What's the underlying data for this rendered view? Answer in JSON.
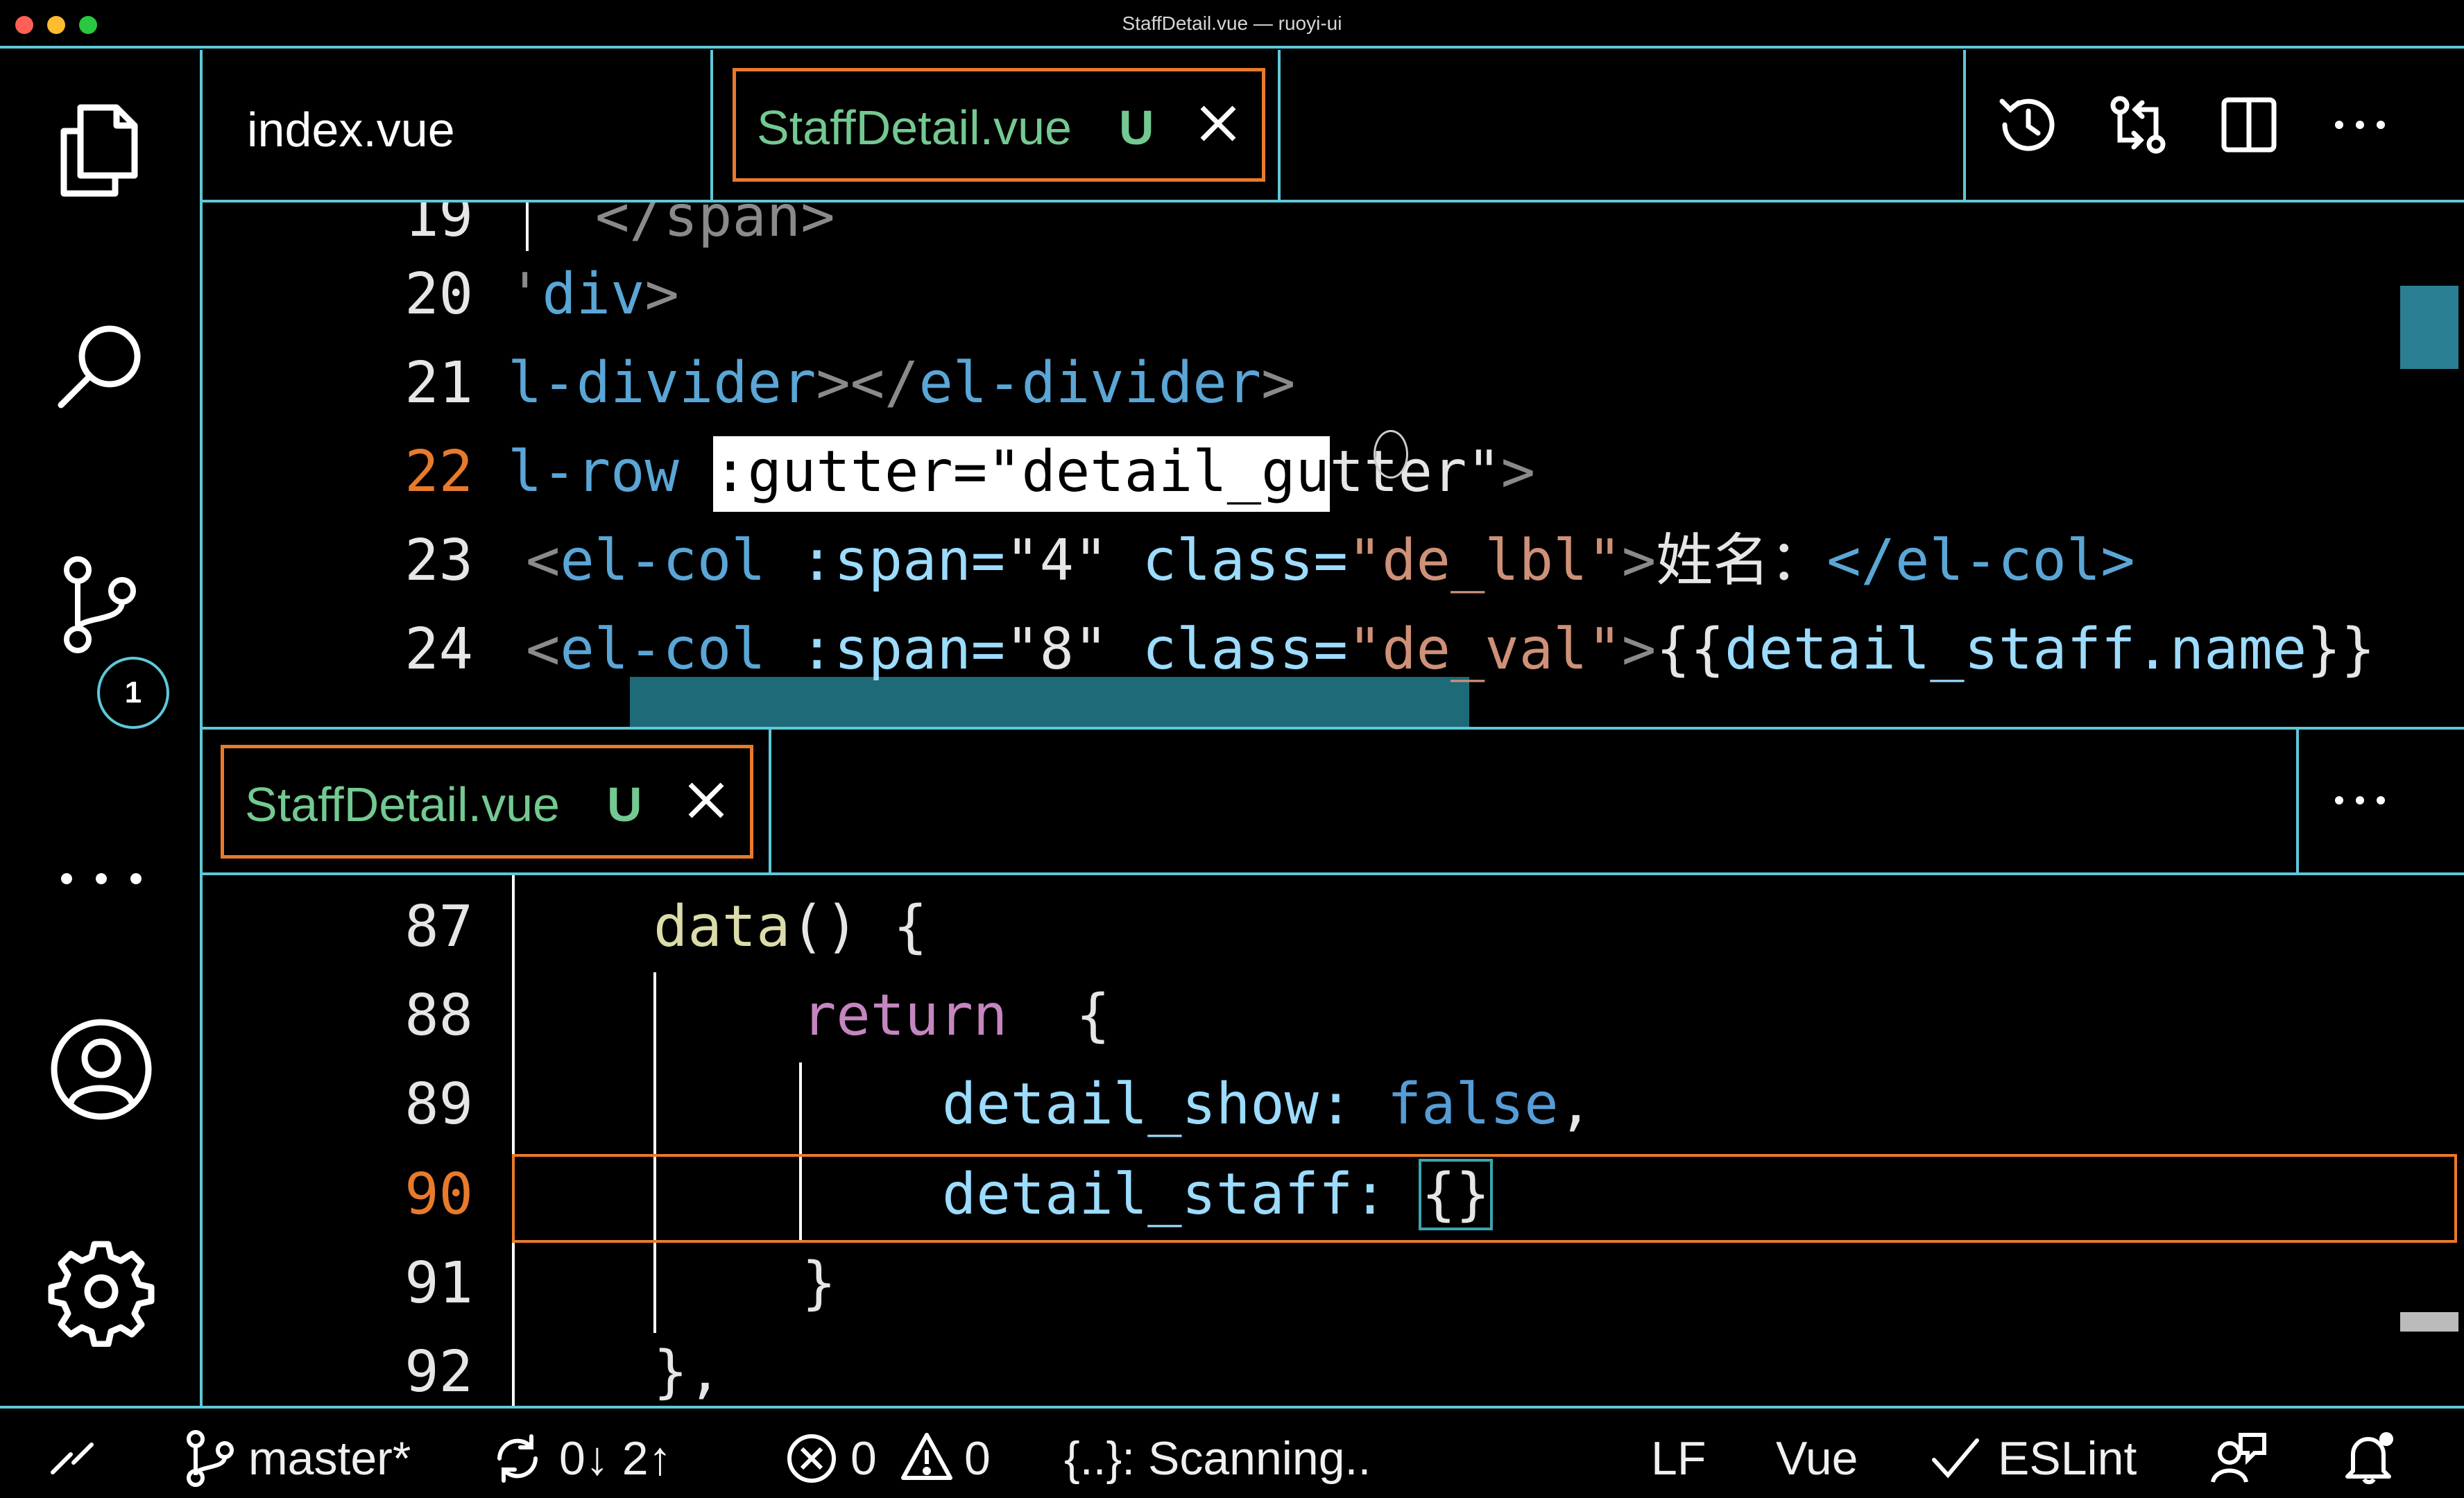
{
  "window": {
    "title": "StaffDetail.vue — ruoyi-ui"
  },
  "tabs_top": {
    "tab1": {
      "label": "index.vue"
    },
    "tab2": {
      "label": "StaffDetail.vue",
      "status": "U"
    }
  },
  "tabs_bottom": {
    "tab1": {
      "label": "StaffDetail.vue",
      "status": "U"
    }
  },
  "editor_top": {
    "line_numbers": [
      "19",
      "20",
      "21",
      "22",
      "23",
      "24"
    ],
    "lines": {
      "l19": "</span>",
      "l20": {
        "a": "'",
        "b": "div",
        "c": ">"
      },
      "l21": {
        "a": "l-divider",
        "b": "></",
        "c": "el-divider",
        "d": ">"
      },
      "l22": {
        "a": "l-row",
        "sel": ":gutter=\"detail_gu",
        "rest": "tter\"",
        "close": ">"
      },
      "l23": {
        "open": "<",
        "tag": "el-col",
        "attr1": ":span=",
        "val1q": "\"",
        "val1": "4",
        "val1q2": "\"",
        "attr2": "class=",
        "str2": "\"de_lbl\"",
        "gt": ">",
        "text": "姓名：",
        "closetag": "</el-col>"
      },
      "l24": {
        "open": "<",
        "tag": "el-col",
        "attr1": ":span=",
        "val1q": "\"",
        "val1": "8",
        "val1q2": "\"",
        "attr2": "class=",
        "str2": "\"de_val\"",
        "gt": ">",
        "mustache": "{{",
        "expr": "detail_staff.name",
        "mustache_end": "}}"
      }
    }
  },
  "editor_bottom": {
    "line_numbers": [
      "87",
      "88",
      "89",
      "90",
      "91",
      "92"
    ],
    "lines": {
      "l87": {
        "fn": "data",
        "rest": "() {"
      },
      "l88": {
        "kw": "return",
        "rest": "  {"
      },
      "l89": {
        "prop": "detail_show:",
        "val": "false",
        "comma": ","
      },
      "l90": {
        "prop": "detail_staff:",
        "val": "{}"
      },
      "l91": "}",
      "l92": "},"
    }
  },
  "statusbar": {
    "branch": "master*",
    "sync": "0↓ 2↑",
    "errors": "0",
    "warnings": "0",
    "scanning": "{..}: Scanning..",
    "eol": "LF",
    "language": "Vue",
    "linter": "ESLint"
  },
  "activity_badge": "1",
  "colors": {
    "accent_border": "#5ec8d8",
    "active_tab_border": "#e87a2c",
    "modified_green": "#73c991",
    "current_line_number": "#e87a2c"
  }
}
